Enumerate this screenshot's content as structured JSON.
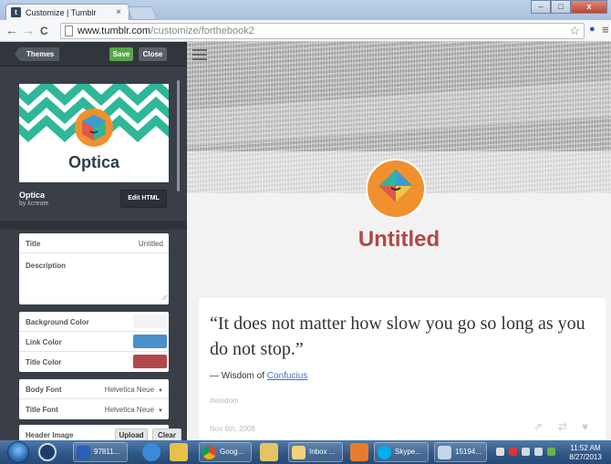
{
  "browser": {
    "tab_title": "Customize | Tumblr",
    "tab_close": "×",
    "favicon_letter": "t",
    "url_host": "www.tumblr.com",
    "url_path": "/customize/forthebook2",
    "back_glyph": "←",
    "forward_glyph": "→",
    "reload_glyph": "C",
    "star_glyph": "☆",
    "menu_glyph": "≡",
    "user_glyph": "●",
    "win_minimize": "–",
    "win_maximize": "□",
    "win_close": "x"
  },
  "sidebar": {
    "themes_label": "Themes",
    "save_label": "Save",
    "close_label": "Close",
    "theme_name": "Optica",
    "theme_card_name": "Optica",
    "theme_author": "by kcreate",
    "edit_html_label": "Edit HTML",
    "title_label": "Title",
    "title_value": "Untitled",
    "description_label": "Description",
    "background_color_label": "Background Color",
    "link_color_label": "Link Color",
    "title_color_label": "Title Color",
    "body_font_label": "Body Font",
    "body_font_value": "Helvetica Neue",
    "title_font_label": "Title Font",
    "title_font_value": "Helvetica Neue",
    "header_image_label": "Header Image",
    "upload_label": "Upload",
    "clear_label": "Clear",
    "resize_grip": "⁄⁄",
    "dropdown_arrow": "▼"
  },
  "colors": {
    "background_color": "#f3f3f4",
    "link_color": "#4a90c8",
    "title_color": "#b2474a",
    "accent_green": "#56a54a",
    "theme_teal": "#2fb79a"
  },
  "preview": {
    "blog_title": "Untitled",
    "quote": "“It does not matter how slow you go so long as you do not stop.”",
    "source_prefix": "— Wisdom of ",
    "source_link": "Confucius",
    "tag": "#wisdom",
    "post_date": "Nov 6th, 2008",
    "share_glyph": "⇗",
    "reblog_glyph": "⇄",
    "like_glyph": "♥"
  },
  "taskbar": {
    "items": [
      {
        "label": "97811..."
      },
      {
        "label": "Goog..."
      },
      {
        "label": "Inbox ..."
      },
      {
        "label": "Skype..."
      },
      {
        "label": "15194..."
      }
    ],
    "clock_time": "11:52 AM",
    "clock_date": "8/27/2013"
  }
}
